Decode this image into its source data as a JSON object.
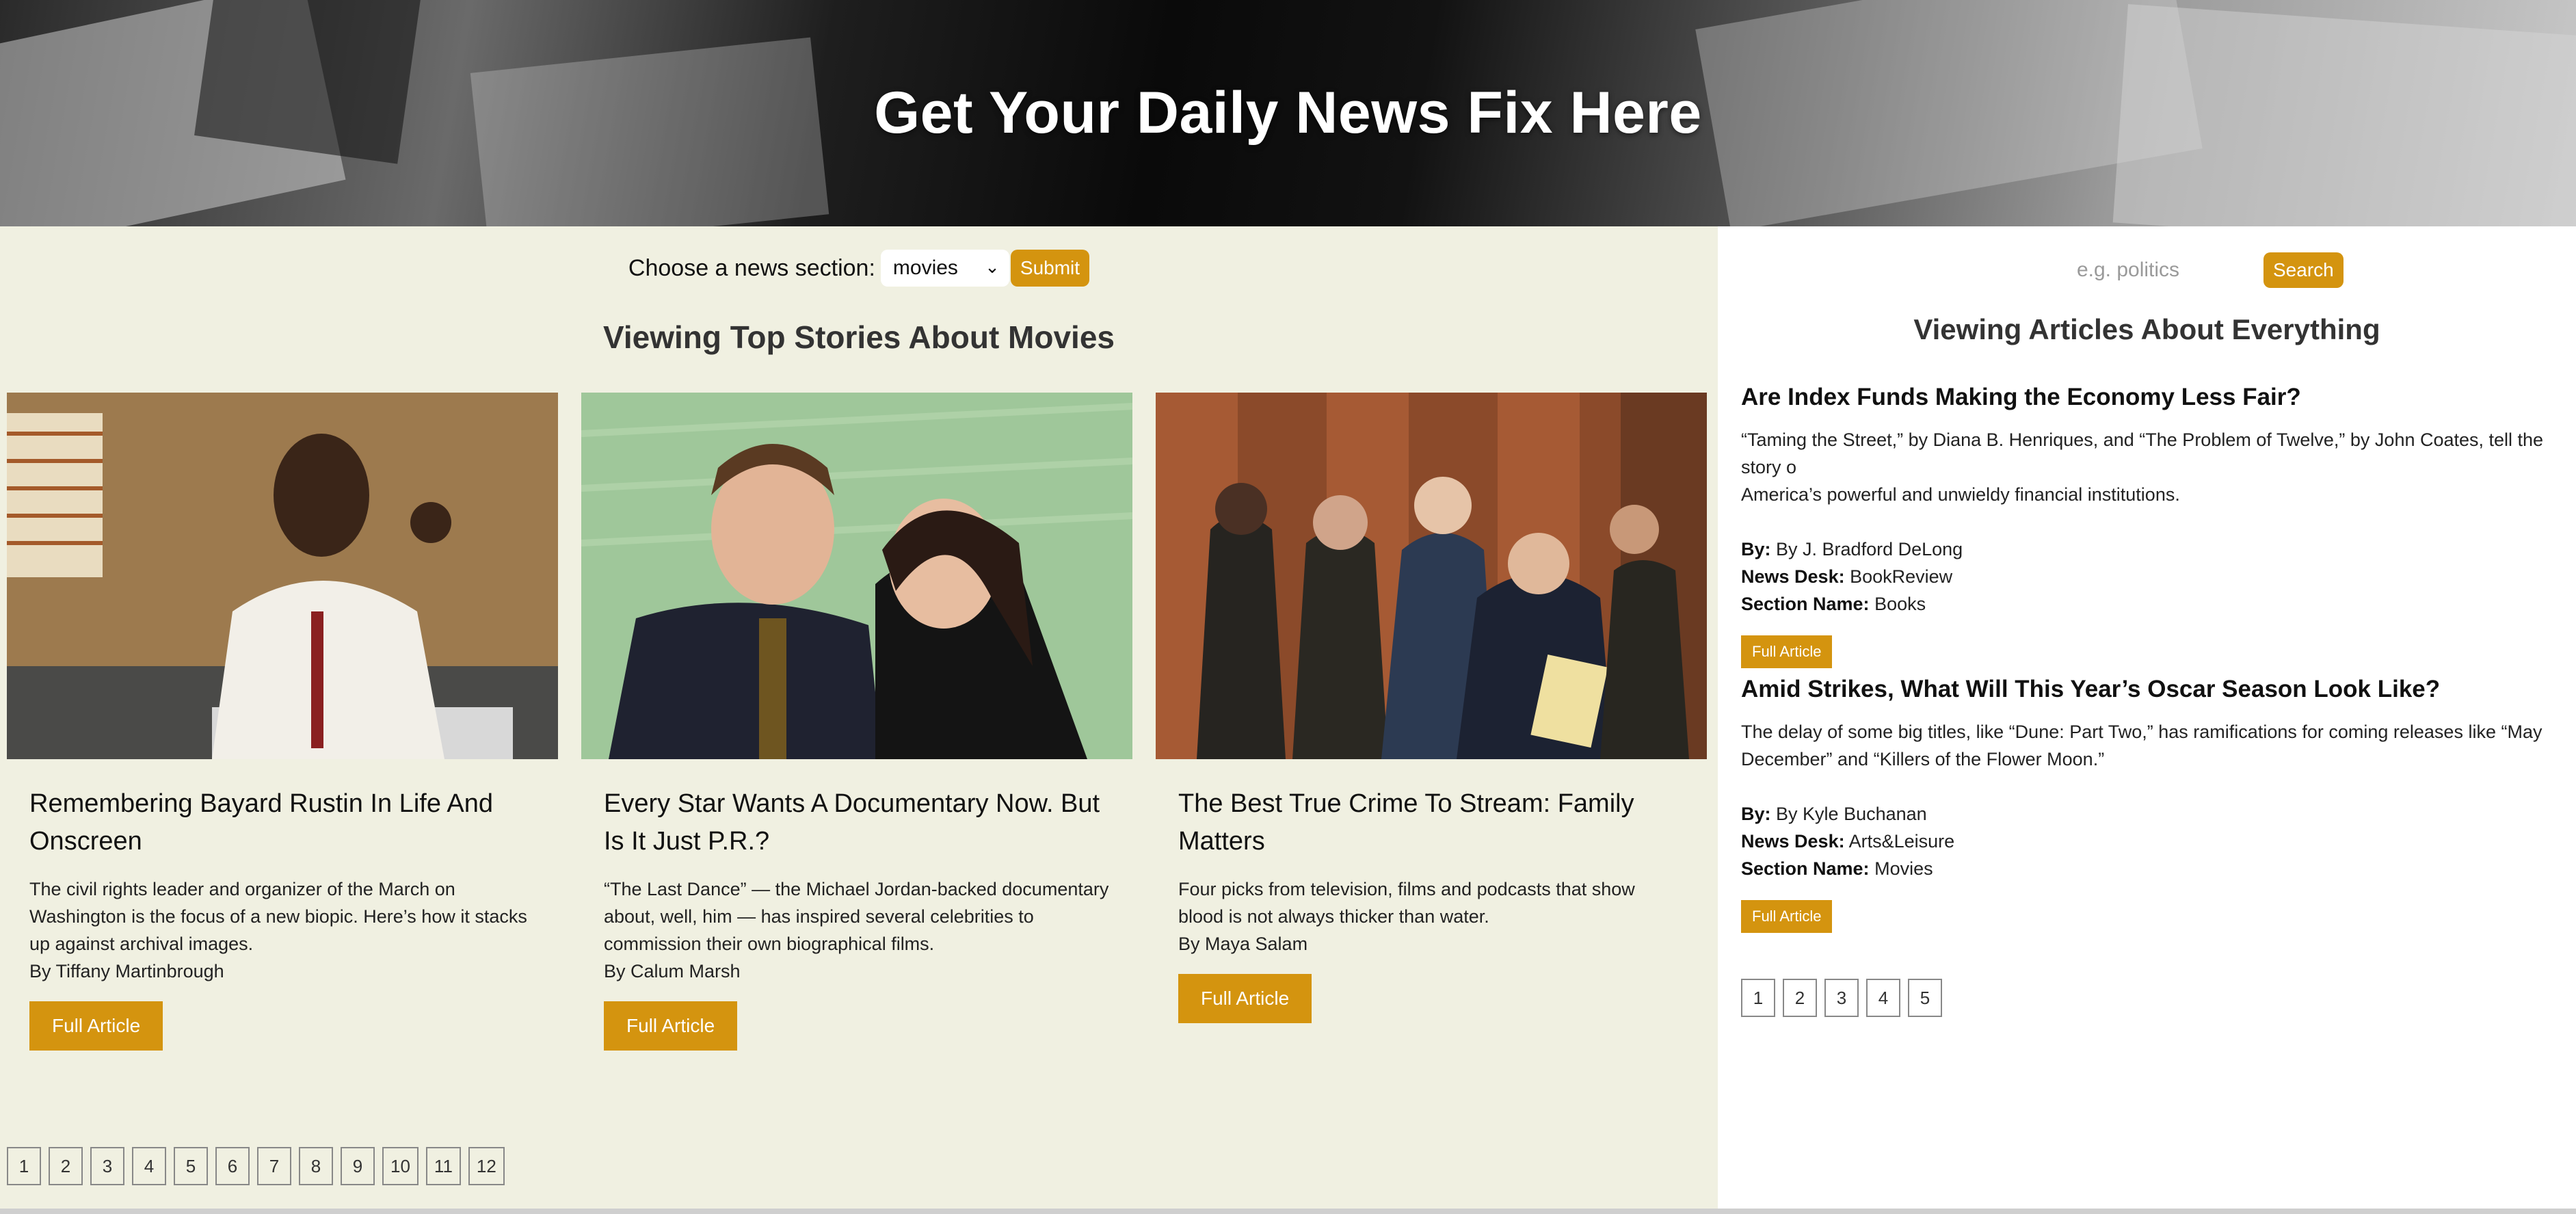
{
  "hero": {
    "title": "Get Your Daily News Fix Here"
  },
  "section_picker": {
    "label": "Choose a news section:",
    "selected": "movies",
    "submit_label": "Submit"
  },
  "main": {
    "heading": "Viewing Top Stories About Movies",
    "cards": [
      {
        "title": "Remembering Bayard Rustin In Life And Onscreen",
        "abstract": "The civil rights leader and organizer of the March on Washington is the focus of a new biopic. Here’s how it stacks up against archival images.",
        "byline": "By Tiffany Martinbrough",
        "button": "Full Article"
      },
      {
        "title": "Every Star Wants A Documentary Now. But Is It Just P.R.?",
        "abstract": "“The Last Dance” — the Michael Jordan-backed documentary about, well, him — has inspired several celebrities to commission their own biographical films.",
        "byline": "By Calum Marsh",
        "button": "Full Article"
      },
      {
        "title": "The Best True Crime To Stream: Family Matters",
        "abstract": "Four picks from television, films and podcasts that show blood is not always thicker than water.",
        "byline": "By Maya Salam",
        "button": "Full Article"
      }
    ],
    "pages": [
      "1",
      "2",
      "3",
      "4",
      "5",
      "6",
      "7",
      "8",
      "9",
      "10",
      "11",
      "12"
    ]
  },
  "sidebar": {
    "search_placeholder": "e.g. politics",
    "search_label": "Search",
    "heading": "Viewing Articles About Everything",
    "labels": {
      "by": "By:",
      "desk": "News Desk:",
      "section": "Section Name:"
    },
    "articles": [
      {
        "title": "Are Index Funds Making the Economy Less Fair?",
        "abstract": "“Taming the Street,” by Diana B. Henriques, and “The Problem of Twelve,” by John Coates, tell the story o\nAmerica’s powerful and unwieldy financial institutions.",
        "by": "By J. Bradford DeLong",
        "desk": "BookReview",
        "section": "Books",
        "button": "Full Article"
      },
      {
        "title": "Amid Strikes, What Will This Year’s Oscar Season Look Like?",
        "abstract": "The delay of some big titles, like “Dune: Part Two,” has ramifications for coming releases like “May\nDecember” and “Killers of the Flower Moon.”",
        "by": "By Kyle Buchanan",
        "desk": "Arts&Leisure",
        "section": "Movies",
        "button": "Full Article"
      }
    ],
    "pages": [
      "1",
      "2",
      "3",
      "4",
      "5"
    ]
  },
  "colors": {
    "accent": "#d4940f",
    "main_bg": "#f0f0e1",
    "sidebar_bg": "#ffffff"
  }
}
